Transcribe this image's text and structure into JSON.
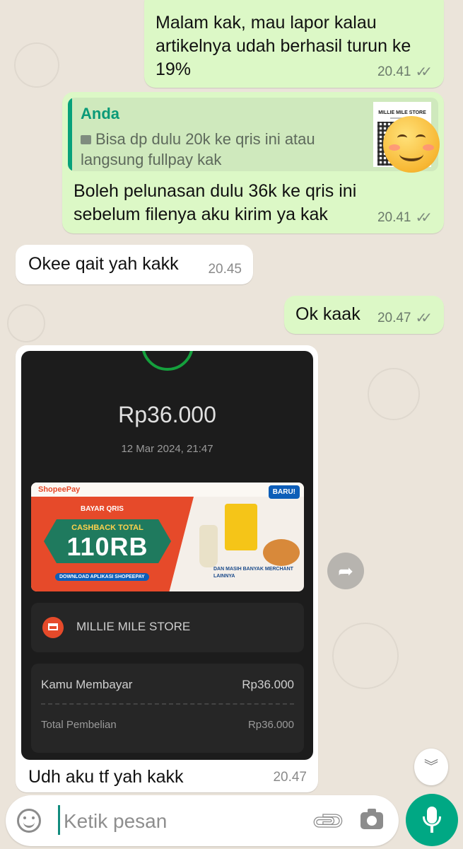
{
  "messages": [
    {
      "id": "m1",
      "direction": "outgoing",
      "text": "Malam kak, mau lapor kalau artikelnya udah berhasil turun ke 19%",
      "time": "20.41",
      "status": "read"
    },
    {
      "id": "m2",
      "direction": "outgoing",
      "reply": {
        "author": "Anda",
        "text": "Bisa dp dulu 20k ke qris ini atau langsung fullpay kak",
        "thumb_title": "MILLIE MILE STORE"
      },
      "text": "Boleh pelunasan dulu 36k ke qris ini sebelum filenya aku kirim ya kak",
      "time": "20.41",
      "status": "read"
    },
    {
      "id": "m3",
      "direction": "incoming",
      "text": "Okee qait yah kakk",
      "time": "20.45"
    },
    {
      "id": "m4",
      "direction": "outgoing",
      "text": "Ok kaak",
      "time": "20.47",
      "status": "read"
    },
    {
      "id": "m5",
      "direction": "incoming",
      "text": "Udh aku tf yah kakk",
      "time": "20.47",
      "image": {
        "amount": "Rp36.000",
        "date": "12 Mar 2024, 21:47",
        "banner": {
          "brand": "ShopeePay",
          "badge": "BARU!",
          "bayar": "BAYAR QRIS",
          "cashback_title": "CASHBACK TOTAL",
          "cashback_value": "110RB",
          "download": "DOWNLOAD APLIKASI SHOPEEPAY",
          "merchant": "DAN MASIH BANYAK MERCHANT LAINNYA"
        },
        "store_name": "MILLIE MILE STORE",
        "rows": [
          {
            "label": "Kamu Membayar",
            "value": "Rp36.000"
          },
          {
            "label": "Total Pembelian",
            "value": "Rp36.000"
          }
        ]
      }
    }
  ],
  "ticks": "✓✓",
  "input": {
    "placeholder": "Ketik pesan"
  },
  "colors": {
    "outgoing": "#dcf8c6",
    "incoming": "#ffffff",
    "accent": "#00a884",
    "quote_author": "#0a9a78"
  },
  "icons": [
    "emoji-icon",
    "attach-icon",
    "camera-icon",
    "mic-icon",
    "forward-icon",
    "scroll-down-icon",
    "image-icon"
  ]
}
